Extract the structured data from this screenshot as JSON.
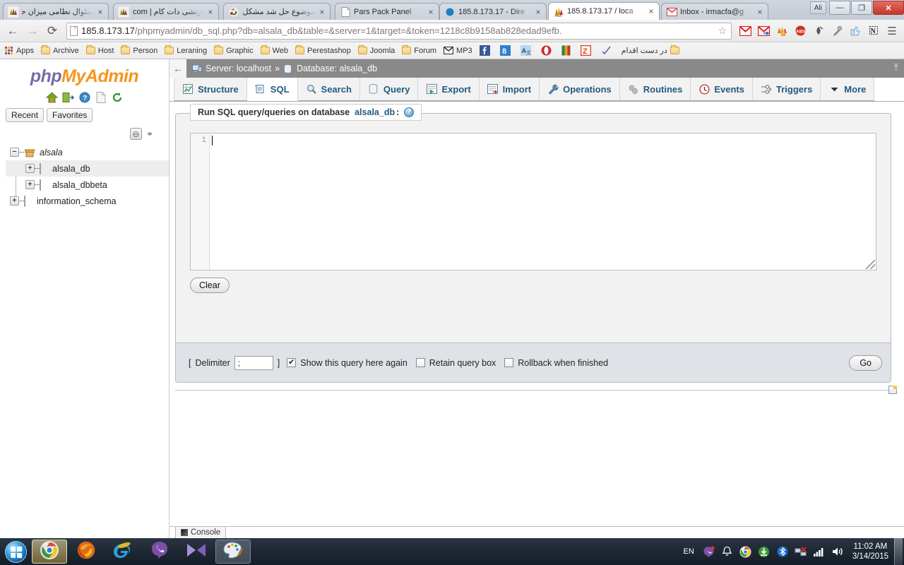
{
  "browser": {
    "tabs": [
      {
        "label": "سئوال نظامی میزان حقو",
        "favicon": "pma-icon",
        "rtl": true,
        "active": false
      },
      {
        "label": "ارتشی دات کام | i.com",
        "favicon": "pma-icon",
        "rtl": true,
        "active": false
      },
      {
        "label": "موضوع حل شد مشکل د",
        "favicon": "joomla-icon",
        "rtl": true,
        "active": false
      },
      {
        "label": "Pars Pack Panel",
        "favicon": "page-icon",
        "rtl": false,
        "active": false
      },
      {
        "label": "185.8.173.17 - Dire",
        "favicon": "circle-icon",
        "rtl": false,
        "active": false
      },
      {
        "label": "185.8.173.17 / loca",
        "favicon": "pma-icon",
        "rtl": false,
        "active": true
      },
      {
        "label": "Inbox - irmacfa@g",
        "favicon": "gmail-icon",
        "rtl": false,
        "active": false
      }
    ],
    "tab_close_label": "×",
    "window": {
      "user_badge": "Ali",
      "minimize": "—",
      "restore": "❐",
      "close": "✕"
    },
    "nav": {
      "back": "←",
      "forward": "→",
      "reload": "⟳",
      "url_prefix": "185.8.173.17",
      "url_rest": "/phpmyadmin/db_sql.php?db=alsala_db&table=&server=1&target=&token=1218c8b9158ab828edad9efb.",
      "star": "☆",
      "menu": "☰",
      "extensions": [
        "gmail-icon",
        "gmail-forward-icon",
        "pma-icon",
        "abs-icon",
        "inkpot-icon",
        "eyedropper-icon",
        "thumbsup-icon",
        "evernote-icon"
      ]
    },
    "bookmarks": [
      {
        "label": "Apps",
        "icon": "apps-grid-icon"
      },
      {
        "label": "Archive",
        "icon": "folder-icon"
      },
      {
        "label": "Host",
        "icon": "folder-icon"
      },
      {
        "label": "Person",
        "icon": "folder-icon"
      },
      {
        "label": "Leraning",
        "icon": "folder-icon"
      },
      {
        "label": "Graphic",
        "icon": "folder-icon"
      },
      {
        "label": "Web",
        "icon": "folder-icon"
      },
      {
        "label": "Perestashop",
        "icon": "folder-icon"
      },
      {
        "label": "Joomla",
        "icon": "folder-icon"
      },
      {
        "label": "Forum",
        "icon": "folder-icon"
      },
      {
        "label": "MP3",
        "icon": "gmail-icon"
      },
      {
        "label": "",
        "icon": "facebook-icon"
      },
      {
        "label": "",
        "icon": "google-plus-icon"
      },
      {
        "label": "",
        "icon": "translate-icon"
      },
      {
        "label": "",
        "icon": "opera-icon"
      },
      {
        "label": "",
        "icon": "book-icon"
      },
      {
        "label": "",
        "icon": "zoomit-icon"
      },
      {
        "label": "",
        "icon": "check-icon"
      },
      {
        "label": "در دست اقدام",
        "icon": "folder-icon"
      }
    ]
  },
  "pma": {
    "logo": {
      "php": "php",
      "my": "My",
      "admin": "Admin"
    },
    "logo_icons": [
      "home-icon",
      "logout-icon",
      "help-icon",
      "docs-icon",
      "reload-icon"
    ],
    "quick_tabs": [
      {
        "label": "Recent"
      },
      {
        "label": "Favorites"
      }
    ],
    "nav_tools": {
      "collapse_label": "⊖",
      "link_label": "⚭"
    },
    "tree": [
      {
        "label": "alsala",
        "type": "server",
        "depth": 0,
        "expander": "−",
        "italic": true,
        "selected": false
      },
      {
        "label": "alsala_db",
        "type": "database",
        "depth": 1,
        "expander": "+",
        "italic": false,
        "selected": true
      },
      {
        "label": "alsala_dbbeta",
        "type": "database",
        "depth": 1,
        "expander": "+",
        "italic": false,
        "selected": false
      },
      {
        "label": "information_schema",
        "type": "database",
        "depth": 0,
        "expander": "+",
        "italic": false,
        "selected": false
      }
    ],
    "breadcrumb": {
      "back": "←",
      "server_label": "Server: localhost",
      "separator": "»",
      "database_label": "Database: alsala_db",
      "collapse": "⤒"
    },
    "nav_tabs": [
      {
        "label": "Structure",
        "icon": "structure-icon",
        "active": false
      },
      {
        "label": "SQL",
        "icon": "sql-icon",
        "active": true
      },
      {
        "label": "Search",
        "icon": "search-icon",
        "active": false
      },
      {
        "label": "Query",
        "icon": "query-icon",
        "active": false
      },
      {
        "label": "Export",
        "icon": "export-icon",
        "active": false
      },
      {
        "label": "Import",
        "icon": "import-icon",
        "active": false
      },
      {
        "label": "Operations",
        "icon": "wrench-icon",
        "active": false
      },
      {
        "label": "Routines",
        "icon": "routines-icon",
        "active": false
      },
      {
        "label": "Events",
        "icon": "clock-icon",
        "active": false
      },
      {
        "label": "Triggers",
        "icon": "triggers-icon",
        "active": false
      },
      {
        "label": "More",
        "icon": "chevron-down-icon",
        "active": false
      }
    ],
    "query_panel": {
      "title_prefix": "Run SQL query/queries on database",
      "title_db": "alsala_db",
      "title_colon": ":",
      "help": "?",
      "line_number": "1",
      "editor_value": "",
      "clear_label": "Clear"
    },
    "options": {
      "bracket_open": "[",
      "delimiter_label": "Delimiter",
      "delimiter_value": ";",
      "bracket_close": "]",
      "show_query_label": "Show this query here again",
      "show_query_checked": true,
      "retain_label": "Retain query box",
      "retain_checked": false,
      "rollback_label": "Rollback when finished",
      "rollback_checked": false,
      "check_glyph": "✔",
      "go_label": "Go"
    },
    "console": {
      "label": "Console"
    }
  },
  "taskbar": {
    "start": "start-orb",
    "apps": [
      {
        "name": "chrome-taskbar-button",
        "icon": "chrome-icon",
        "state": "active"
      },
      {
        "name": "firefox-taskbar-button",
        "icon": "firefox-icon",
        "state": "pinned"
      },
      {
        "name": "ie-taskbar-button",
        "icon": "internet-explorer-icon",
        "state": "pinned"
      },
      {
        "name": "viber-taskbar-button",
        "icon": "viber-icon",
        "state": "pinned"
      },
      {
        "name": "moviemaker-taskbar-button",
        "icon": "movie-maker-icon",
        "state": "pinned"
      },
      {
        "name": "paint-taskbar-button",
        "icon": "paint-icon",
        "state": "open"
      }
    ],
    "tray": {
      "language": "EN",
      "icons": [
        "viber-tray-icon",
        "notification-bell-icon",
        "chrome-tray-icon",
        "download-manager-icon",
        "bluetooth-icon",
        "network-disconnected-icon",
        "signal-bars-icon",
        "volume-icon"
      ],
      "time": "11:02 AM",
      "date": "3/14/2015"
    }
  }
}
